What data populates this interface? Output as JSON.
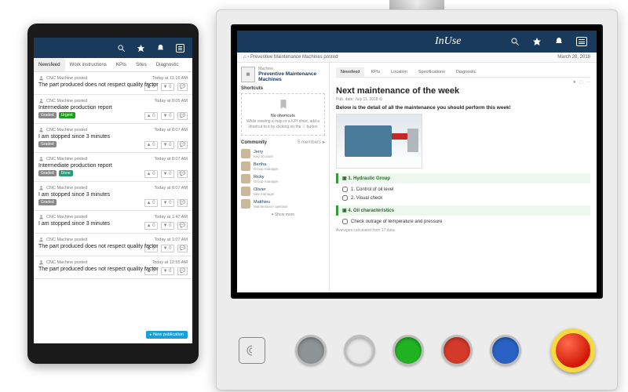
{
  "tablet": {
    "tabs": [
      "Newsfeed",
      "Work instructions",
      "KPIs",
      "Sites",
      "Diagnostic"
    ],
    "active_tab": 0,
    "float_button": "▸ New publication",
    "feed": [
      {
        "author": "CNC Machine posted",
        "time": "Today at 11:16 AM",
        "title": "The part produced does not respect quality factor",
        "badges": []
      },
      {
        "author": "CNC Machine posted",
        "time": "Today at 8:05 AM",
        "title": "Intermediate production report",
        "badges": [
          {
            "cls": "grey",
            "txt": "Graded"
          },
          {
            "cls": "green",
            "txt": "Urgent"
          }
        ]
      },
      {
        "author": "CNC Machine posted",
        "time": "Today at 8:07 AM",
        "title": "I am stopped since 3 minutes",
        "badges": [
          {
            "cls": "grey",
            "txt": "Graded"
          }
        ]
      },
      {
        "author": "CNC Machine posted",
        "time": "Today at 8:07 AM",
        "title": "Intermediate production report",
        "badges": [
          {
            "cls": "grey",
            "txt": "Graded"
          },
          {
            "cls": "teal",
            "txt": "Done"
          }
        ]
      },
      {
        "author": "CNC Machine posted",
        "time": "Today at 8:07 AM",
        "title": "I am stopped since 3 minutes",
        "badges": [
          {
            "cls": "grey",
            "txt": "Graded"
          }
        ]
      },
      {
        "author": "CNC Machine posted",
        "time": "Today at 1:47 AM",
        "title": "I am stopped since 3 minutes",
        "badges": []
      },
      {
        "author": "CNC Machine posted",
        "time": "Today at 1:07 AM",
        "title": "The part produced does not respect quality factor",
        "badges": []
      },
      {
        "author": "CNC Machine posted",
        "time": "Today at 12:55 AM",
        "title": "The part produced does not respect quality factor",
        "badges": []
      }
    ]
  },
  "panel": {
    "brand": "InUse",
    "breadcrumb": "⌂ › Preventive Maintenance Machines posted",
    "breadcrumb_date": "March 20, 2018",
    "machine_label": "Machine",
    "machine_name": "Preventive Maintenance Machines",
    "side": {
      "shortcuts_title": "Shortcuts",
      "shortcuts_empty_title": "No shortcuts",
      "shortcuts_empty_body": "While viewing a map or a KPI chart, add a shortcut to it by clicking on the ☆ button",
      "community_title": "Community",
      "community_meta": "5 members",
      "members": [
        {
          "name": "Jerry",
          "role": "Key account"
        },
        {
          "name": "Bertha",
          "role": "Group manager"
        },
        {
          "name": "Ricky",
          "role": "Group manager"
        },
        {
          "name": "Olivier",
          "role": "Site manager"
        },
        {
          "name": "Matthieu",
          "role": "Maintenance operator"
        }
      ],
      "show_more": "Show more"
    },
    "main": {
      "tabs": [
        "Newsfeed",
        "KPIs",
        "Location",
        "Specifications",
        "Diagnostic"
      ],
      "active_tab": 0,
      "title": "Next maintenance of the week",
      "pub_date": "Pub. date: July 11, 2018 ⏲",
      "desc": "Below is the detail of all the maintenance you should perform this week!",
      "sections": [
        {
          "head": "1. Hydraulic Group",
          "tasks": [
            "1. Control of oil level",
            "2. Visual check"
          ]
        },
        {
          "head": "4. Oil characteristics",
          "tasks": [
            "Check outrage of temperature and pressure"
          ]
        }
      ],
      "footer_note": "Averages calculated from 17 data."
    }
  }
}
